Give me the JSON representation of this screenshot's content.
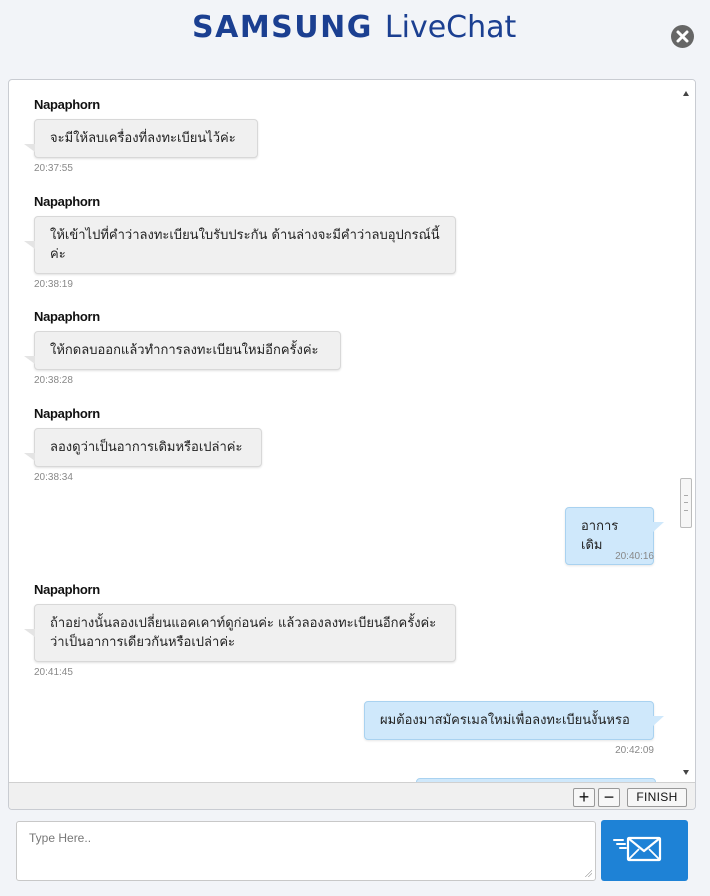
{
  "header": {
    "brand": "SAMSUNG",
    "product": "LiveChat",
    "close_icon": "close-circle-icon"
  },
  "messages": [
    {
      "type": "agent",
      "sender": "Napaphorn",
      "text": "จะมีให้ลบเครื่องที่ลงทะเบียนไว้ค่ะ",
      "time": "20:37:55"
    },
    {
      "type": "agent",
      "sender": "Napaphorn",
      "text": "ให้เข้าไปที่คำว่าลงทะเบียนใบรับประกัน ด้านล่างจะมีคำว่าลบอุปกรณ์นี้ค่ะ",
      "time": "20:38:19"
    },
    {
      "type": "agent",
      "sender": "Napaphorn",
      "text": "ให้กดลบออกแล้วทำการลงทะเบียนใหม่อีกครั้งค่ะ",
      "time": "20:38:28"
    },
    {
      "type": "agent",
      "sender": "Napaphorn",
      "text": "ลองดูว่าเป็นอาการเดิมหรือเปล่าค่ะ",
      "time": "20:38:34"
    },
    {
      "type": "user",
      "text": "อาการเดิม",
      "time": "20:40:16"
    },
    {
      "type": "agent",
      "sender": "Napaphorn",
      "text": "ถ้าอย่างนั้นลองเปลี่ยนแอคเคาท์ดูก่อนค่ะ แล้วลองลงทะเบียนอีกครั้งค่ะ ว่าเป็นอาการเดียวกันหรือเปล่าค่ะ",
      "time": "20:41:45"
    },
    {
      "type": "user",
      "text": "ผมต้องมาสมัครเมลใหม่เพื่อลงทะเบียนงั้นหรอ",
      "time": "20:42:09"
    }
  ],
  "toolbar": {
    "zoom_in_label": "+",
    "zoom_out_label": "−",
    "finish_label": "FINISH"
  },
  "composer": {
    "placeholder": "Type Here..",
    "value": "",
    "send_icon": "envelope-send-icon"
  },
  "colors": {
    "brand_blue": "#1b3f91",
    "send_button": "#1e82d6",
    "user_bubble": "#cfe8fb",
    "agent_bubble": "#f0f0f0"
  }
}
